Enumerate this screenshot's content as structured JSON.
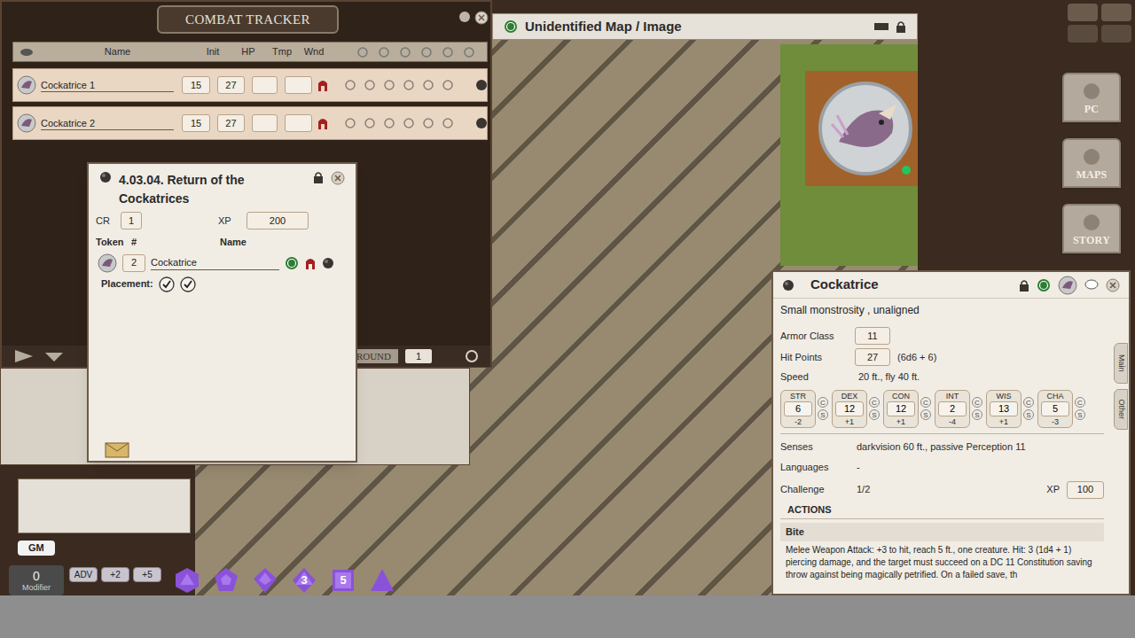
{
  "combat_tracker": {
    "title": "COMBAT TRACKER",
    "columns": [
      "Name",
      "Init",
      "HP",
      "Tmp",
      "Wnd"
    ],
    "rows": [
      {
        "name": "Cockatrice 1",
        "init": "15",
        "hp": "27"
      },
      {
        "name": "Cockatrice 2",
        "init": "15",
        "hp": "27"
      }
    ],
    "round_label": "ROUND",
    "round": "1"
  },
  "encounter": {
    "title": "4.03.04. Return of the Cockatrices",
    "cr_label": "CR",
    "cr": "1",
    "xp_label": "XP",
    "xp": "200",
    "columns": [
      "Token",
      "#",
      "Name"
    ],
    "rows": [
      {
        "count": "2",
        "name": "Cockatrice"
      }
    ],
    "placement_label": "Placement:",
    "placements": [
      {
        "checked": true
      },
      {
        "checked": true
      }
    ]
  },
  "map": {
    "title": "Unidentified Map / Image"
  },
  "sidebar": {
    "buttons": [
      "PC",
      "MAPS",
      "STORY"
    ]
  },
  "chat": {
    "role": "GM",
    "modifier": "0",
    "modifier_label": "Modifier",
    "mod_buttons": [
      "ADV",
      "+2",
      "+5"
    ],
    "dice": [
      {
        "kind": "d20"
      },
      {
        "kind": "d12"
      },
      {
        "kind": "d10"
      },
      {
        "kind": "d8",
        "label": "3"
      },
      {
        "kind": "d6",
        "label": "5"
      },
      {
        "kind": "d4"
      }
    ]
  },
  "stat_block": {
    "title": "Cockatrice",
    "type": "Small monstrosity , unaligned",
    "ac_label": "Armor Class",
    "ac": "11",
    "hp_label": "Hit Points",
    "hp": "27",
    "hp_formula": "(6d6 + 6)",
    "speed_label": "Speed",
    "speed": "20 ft., fly 40 ft.",
    "check_label": "C",
    "save_label": "S",
    "abilities": [
      {
        "name": "STR",
        "score": "6",
        "mod": "-2"
      },
      {
        "name": "DEX",
        "score": "12",
        "mod": "+1"
      },
      {
        "name": "CON",
        "score": "12",
        "mod": "+1"
      },
      {
        "name": "INT",
        "score": "2",
        "mod": "-4"
      },
      {
        "name": "WIS",
        "score": "13",
        "mod": "+1"
      },
      {
        "name": "CHA",
        "score": "5",
        "mod": "-3"
      }
    ],
    "senses_label": "Senses",
    "senses": "darkvision 60 ft., passive Perception 11",
    "languages_label": "Languages",
    "languages": "-",
    "challenge_label": "Challenge",
    "challenge": "1/2",
    "xp_label": "XP",
    "xp": "100",
    "actions_header": "ACTIONS",
    "action_name": "Bite",
    "action_text": "Melee Weapon Attack: +3 to hit, reach 5 ft., one creature. Hit: 3 (1d4 + 1) piercing damage, and the target must succeed on a DC 11 Constitution saving throw against being magically petrified. On a failed save, th",
    "tabs": [
      "Main",
      "Other"
    ]
  }
}
